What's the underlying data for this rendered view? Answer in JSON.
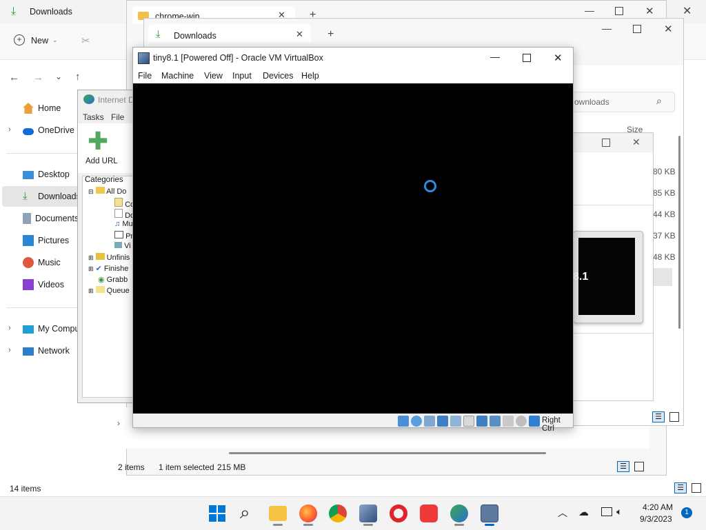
{
  "explorer_back": {
    "tab_title": "Downloads",
    "new_label": "New",
    "nav": [
      {
        "label": "Home"
      },
      {
        "label": "OneDrive"
      },
      {
        "label": "Desktop"
      },
      {
        "label": "Downloads"
      },
      {
        "label": "Documents"
      },
      {
        "label": "Pictures"
      },
      {
        "label": "Music"
      },
      {
        "label": "Videos"
      },
      {
        "label": "My Computer"
      },
      {
        "label": "Network"
      }
    ],
    "status_items": "14 items"
  },
  "explorer_mid": {
    "tab_title": "chrome-win",
    "status_count": "2 items",
    "status_selected": "1 item selected",
    "status_size": "215 MB"
  },
  "explorer_front": {
    "tab_title": "Downloads",
    "search_placeholder": "ownloads",
    "size_header": "Size",
    "sizes": [
      "80 KB",
      "85 KB",
      "44 KB",
      "37 KB",
      "48 KB"
    ]
  },
  "idm": {
    "title": "Internet D",
    "menu_tasks": "Tasks",
    "menu_file": "File",
    "add_url": "Add URL",
    "categories_header": "Categories",
    "tree": [
      {
        "label": "All Do"
      },
      {
        "label": "Co"
      },
      {
        "label": "Do"
      },
      {
        "label": "Mu"
      },
      {
        "label": "Pr"
      },
      {
        "label": "Vi"
      },
      {
        "label": "Unfinis"
      },
      {
        "label": "Finishe"
      },
      {
        "label": "Grabb"
      },
      {
        "label": "Queue"
      }
    ]
  },
  "preview_text": "8.1",
  "vbox": {
    "title": "tiny8.1 [Powered Off] - Oracle VM VirtualBox",
    "menu": [
      "File",
      "Machine",
      "View",
      "Input",
      "Devices",
      "Help"
    ],
    "host_key": "Right Ctrl"
  },
  "taskbar": {
    "time": "4:20 AM",
    "date": "9/3/2023",
    "notification_count": "1"
  },
  "colors": {
    "accent": "#0067c0",
    "download_green": "#1a9c3a",
    "vm_screen": "#000000",
    "spinner": "#2b8de0"
  }
}
